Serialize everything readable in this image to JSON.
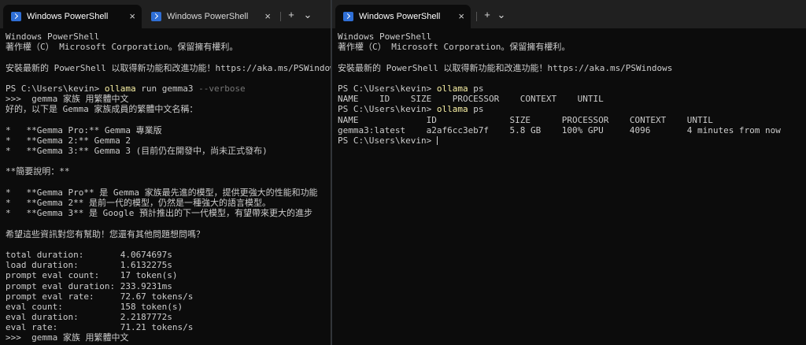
{
  "left_window": {
    "tabs": [
      {
        "label": "Windows PowerShell",
        "active": true
      },
      {
        "label": "Windows PowerShell",
        "active": false
      }
    ],
    "new_tab_symbol": "+",
    "dropdown_symbol": "⌄",
    "close_symbol": "×",
    "lines": [
      {
        "parts": [
          {
            "t": "Windows PowerShell"
          }
        ]
      },
      {
        "parts": [
          {
            "t": "著作權（C） Microsoft Corporation。保留擁有權利。"
          }
        ]
      },
      {
        "parts": [
          {
            "t": ""
          }
        ]
      },
      {
        "parts": [
          {
            "t": "安裝最新的 PowerShell 以取得新功能和改進功能！https://aka.ms/PSWindows"
          }
        ]
      },
      {
        "parts": [
          {
            "t": ""
          }
        ]
      },
      {
        "parts": [
          {
            "t": "PS C:\\Users\\kevin> "
          },
          {
            "t": "ollama",
            "c": "cmd"
          },
          {
            "t": " run gemma3 "
          },
          {
            "t": "--verbose",
            "c": "param"
          }
        ]
      },
      {
        "parts": [
          {
            "t": ">>>  gemma 家族 用繁體中文"
          }
        ]
      },
      {
        "parts": [
          {
            "t": "好的，以下是 Gemma 家族成員的繁體中文名稱："
          }
        ]
      },
      {
        "parts": [
          {
            "t": ""
          }
        ]
      },
      {
        "parts": [
          {
            "t": "*   **Gemma Pro:** Gemma 專業版"
          }
        ]
      },
      {
        "parts": [
          {
            "t": "*   **Gemma 2:** Gemma 2"
          }
        ]
      },
      {
        "parts": [
          {
            "t": "*   **Gemma 3:** Gemma 3 (目前仍在開發中，尚未正式發布)"
          }
        ]
      },
      {
        "parts": [
          {
            "t": ""
          }
        ]
      },
      {
        "parts": [
          {
            "t": "**簡要說明：**"
          }
        ]
      },
      {
        "parts": [
          {
            "t": ""
          }
        ]
      },
      {
        "parts": [
          {
            "t": "*   **Gemma Pro** 是 Gemma 家族最先進的模型，提供更強大的性能和功能"
          }
        ]
      },
      {
        "parts": [
          {
            "t": "*   **Gemma 2** 是前一代的模型，仍然是一種強大的語言模型。"
          }
        ]
      },
      {
        "parts": [
          {
            "t": "*   **Gemma 3** 是 Google 預計推出的下一代模型，有望帶來更大的進步"
          }
        ]
      },
      {
        "parts": [
          {
            "t": ""
          }
        ]
      },
      {
        "parts": [
          {
            "t": "希望這些資訊對您有幫助！您還有其他問題想問嗎？"
          }
        ]
      },
      {
        "parts": [
          {
            "t": ""
          }
        ]
      },
      {
        "parts": [
          {
            "t": "total duration:       4.0674697s"
          }
        ]
      },
      {
        "parts": [
          {
            "t": "load duration:        1.6132275s"
          }
        ]
      },
      {
        "parts": [
          {
            "t": "prompt eval count:    17 token(s)"
          }
        ]
      },
      {
        "parts": [
          {
            "t": "prompt eval duration: 233.9231ms"
          }
        ]
      },
      {
        "parts": [
          {
            "t": "prompt eval rate:     72.67 tokens/s"
          }
        ]
      },
      {
        "parts": [
          {
            "t": "eval count:           158 token(s)"
          }
        ]
      },
      {
        "parts": [
          {
            "t": "eval duration:        2.2187772s"
          }
        ]
      },
      {
        "parts": [
          {
            "t": "eval rate:            71.21 tokens/s"
          }
        ]
      },
      {
        "parts": [
          {
            "t": ">>>  gemma 家族 用繁體中文"
          }
        ]
      }
    ]
  },
  "right_window": {
    "tabs": [
      {
        "label": "Windows PowerShell",
        "active": true
      }
    ],
    "new_tab_symbol": "+",
    "dropdown_symbol": "⌄",
    "close_symbol": "×",
    "lines": [
      {
        "parts": [
          {
            "t": "Windows PowerShell"
          }
        ]
      },
      {
        "parts": [
          {
            "t": "著作權（C） Microsoft Corporation。保留擁有權利。"
          }
        ]
      },
      {
        "parts": [
          {
            "t": ""
          }
        ]
      },
      {
        "parts": [
          {
            "t": "安裝最新的 PowerShell 以取得新功能和改進功能！https://aka.ms/PSWindows"
          }
        ]
      },
      {
        "parts": [
          {
            "t": ""
          }
        ]
      },
      {
        "parts": [
          {
            "t": "PS C:\\Users\\kevin> "
          },
          {
            "t": "ollama",
            "c": "cmd"
          },
          {
            "t": " ps"
          }
        ]
      },
      {
        "parts": [
          {
            "t": "NAME    ID    SIZE    PROCESSOR    CONTEXT    UNTIL"
          }
        ]
      },
      {
        "parts": [
          {
            "t": "PS C:\\Users\\kevin> "
          },
          {
            "t": "ollama",
            "c": "cmd"
          },
          {
            "t": " ps"
          }
        ]
      },
      {
        "parts": [
          {
            "t": "NAME             ID              SIZE      PROCESSOR    CONTEXT    UNTIL"
          }
        ]
      },
      {
        "parts": [
          {
            "t": "gemma3:latest    a2af6cc3eb7f    5.8 GB    100% GPU     4096       4 minutes from now"
          }
        ]
      },
      {
        "parts": [
          {
            "t": "PS C:\\Users\\kevin> "
          }
        ],
        "cursor": true
      }
    ]
  }
}
